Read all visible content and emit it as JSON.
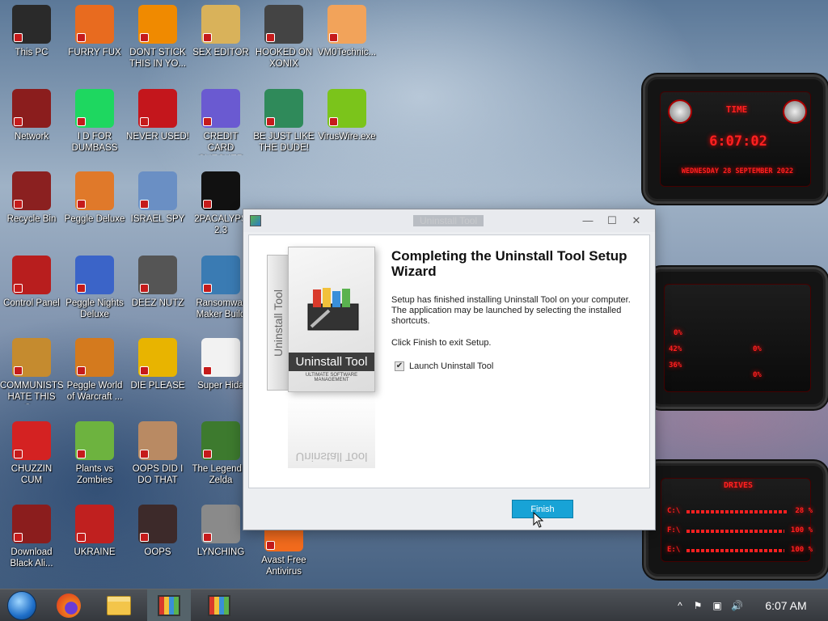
{
  "desktop_icons": [
    {
      "label": "This PC",
      "icon": "monitor-icon",
      "color": "#2a2a2a"
    },
    {
      "label": "FURRY FUX",
      "icon": "firefox-icon",
      "color": "#e86b1f"
    },
    {
      "label": "DONT STICK THIS IN YO...",
      "icon": "traffic-cone-icon",
      "color": "#f08a00"
    },
    {
      "label": "SEX EDITOR",
      "icon": "hxd-icon",
      "color": "#d9b25a"
    },
    {
      "label": "HOOKED ON XONIX",
      "icon": "xonix-icon",
      "color": "#444444"
    },
    {
      "label": "VM0Technic...",
      "icon": "doctor-icon",
      "color": "#f2a35a"
    },
    {
      "label": "Network",
      "icon": "alien-icon",
      "color": "#8b1d1d"
    },
    {
      "label": "I D FOR DUMBASS",
      "icon": "spotify-icon",
      "color": "#1ed760"
    },
    {
      "label": "NEVER USED!",
      "icon": "devcpp-icon",
      "color": "#c4161c"
    },
    {
      "label": "CREDIT CARD CHECKER",
      "icon": "credit-card-icon",
      "color": "#6a5ad1"
    },
    {
      "label": "BE JUST LIKE THE DUDE!",
      "icon": "gnome-icon",
      "color": "#2f8a5a"
    },
    {
      "label": "VirusWire.exe",
      "icon": "lime-icon",
      "color": "#7bc41b"
    },
    {
      "label": "Recycle Bin",
      "icon": "trash-icon",
      "color": "#8b2020"
    },
    {
      "label": "Peggle Deluxe",
      "icon": "peggle-icon",
      "color": "#e0792a"
    },
    {
      "label": "ISRAEL SPY",
      "icon": "network-share-icon",
      "color": "#6a8fc4"
    },
    {
      "label": "2PACALYPS 2.3",
      "icon": "terminal-icon",
      "color": "#111111"
    },
    {
      "label": "Control Panel",
      "icon": "control-panel-icon",
      "color": "#b81e1e"
    },
    {
      "label": "Peggle Nights Deluxe",
      "icon": "peggle-nights-icon",
      "color": "#3b64c8"
    },
    {
      "label": "DEEZ NUTZ",
      "icon": "stack-icon",
      "color": "#555555"
    },
    {
      "label": "Ransomwar Maker Build",
      "icon": "window-app-icon",
      "color": "#3a7bb3"
    },
    {
      "label": "COMMUNISTS HATE THIS G...",
      "icon": "money-bag-icon",
      "color": "#c58b2f"
    },
    {
      "label": "Peggle World of Warcraft ...",
      "icon": "peggle-wow-icon",
      "color": "#d47a1e"
    },
    {
      "label": "DIE PLEASE",
      "icon": "de-icon",
      "color": "#e8b400"
    },
    {
      "label": "Super Hida",
      "icon": "pixel-dog-icon",
      "color": "#f2f2f2"
    },
    {
      "label": "CHUZZIN CUM",
      "icon": "chuzzle-icon",
      "color": "#d42222"
    },
    {
      "label": "Plants vs Zombies",
      "icon": "plant-icon",
      "color": "#6db33f"
    },
    {
      "label": "OOPS DID I DO THAT",
      "icon": "portrait-icon",
      "color": "#b98a63"
    },
    {
      "label": "The Legend o Zelda",
      "icon": "link-sprite-icon",
      "color": "#3d7a2e"
    },
    {
      "label": "Download Black Ali...",
      "icon": "alien-icon",
      "color": "#8b1d1d"
    },
    {
      "label": "UKRAINE",
      "icon": "radiation-icon",
      "color": "#c0201f"
    },
    {
      "label": "OOPS",
      "icon": "dark-box-icon",
      "color": "#3d2a2a"
    },
    {
      "label": "LYNCHING",
      "icon": "noose-icon",
      "color": "#8a8a8a"
    },
    {
      "label": "Avast Free Antivirus",
      "icon": "avast-icon",
      "color": "#f26b1d"
    }
  ],
  "gadgets": {
    "clock": {
      "title": "TIME",
      "time": "6:07:02",
      "date": "WEDNESDAY 28 SEPTEMBER 2022"
    },
    "cpu": {
      "values": [
        "0%",
        "42%",
        "36%",
        "0%",
        "0%"
      ]
    },
    "drives": {
      "title": "DRIVES",
      "items": [
        {
          "letter": "C:\\",
          "value": "28 %"
        },
        {
          "letter": "F:\\",
          "value": "100 %"
        },
        {
          "letter": "E:\\",
          "value": "100 %"
        }
      ]
    }
  },
  "dialog": {
    "title": "Uninstall Tool",
    "heading": "Completing the Uninstall Tool Setup Wizard",
    "body_text": "Setup has finished installing Uninstall Tool on your computer. The application may be launched by selecting the installed shortcuts.",
    "finish_text": "Click Finish to exit Setup.",
    "checkbox_label": "Launch Uninstall Tool",
    "checkbox_checked": true,
    "finish_button": "Finish",
    "box_label": "Uninstall Tool",
    "box_sub": "ULTIMATE SOFTWARE MANAGEMENT",
    "minimize": "—",
    "maximize": "☐",
    "close": "✕"
  },
  "taskbar": {
    "clock": "6:07 AM",
    "items": [
      "start-orb",
      "firefox",
      "file-explorer",
      "uninstall-tool-active",
      "uninstall-tool"
    ]
  }
}
